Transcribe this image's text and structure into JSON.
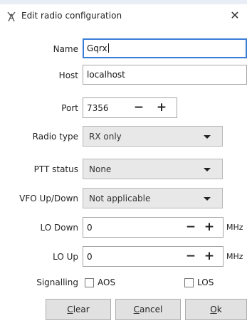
{
  "window": {
    "title": "Edit radio configuration",
    "close_glyph": "✕"
  },
  "fields": {
    "name": {
      "label": "Name",
      "value": "Gqrx"
    },
    "host": {
      "label": "Host",
      "value": "localhost"
    },
    "port": {
      "label": "Port",
      "value": "7356",
      "minus": "−",
      "plus": "+"
    }
  },
  "dropdowns": {
    "radio_type": {
      "label": "Radio type",
      "value": "RX only"
    },
    "ptt_status": {
      "label": "PTT status",
      "value": "None"
    },
    "vfo_updown": {
      "label": "VFO Up/Down",
      "value": "Not applicable"
    }
  },
  "lo": {
    "down": {
      "label": "LO Down",
      "value": "0",
      "minus": "−",
      "plus": "+",
      "unit": "MHz"
    },
    "up": {
      "label": "LO Up",
      "value": "0",
      "minus": "−",
      "plus": "+",
      "unit": "MHz"
    }
  },
  "signalling": {
    "label": "Signalling",
    "aos": {
      "label": "AOS",
      "checked": false
    },
    "los": {
      "label": "LOS",
      "checked": false
    }
  },
  "buttons": {
    "clear": {
      "mnemonic": "C",
      "rest": "lear"
    },
    "cancel": {
      "mnemonic": "C",
      "rest": "ancel"
    },
    "ok": {
      "mnemonic": "O",
      "rest": "k"
    }
  },
  "icons": {
    "title": "radio-tower-icon",
    "close": "close-icon",
    "dropdown": "chevron-down-icon"
  },
  "colors": {
    "focus_border": "#3b7dd8",
    "dropdown_bg": "#e8e8e8",
    "button_bg": "#e1e1e1"
  }
}
